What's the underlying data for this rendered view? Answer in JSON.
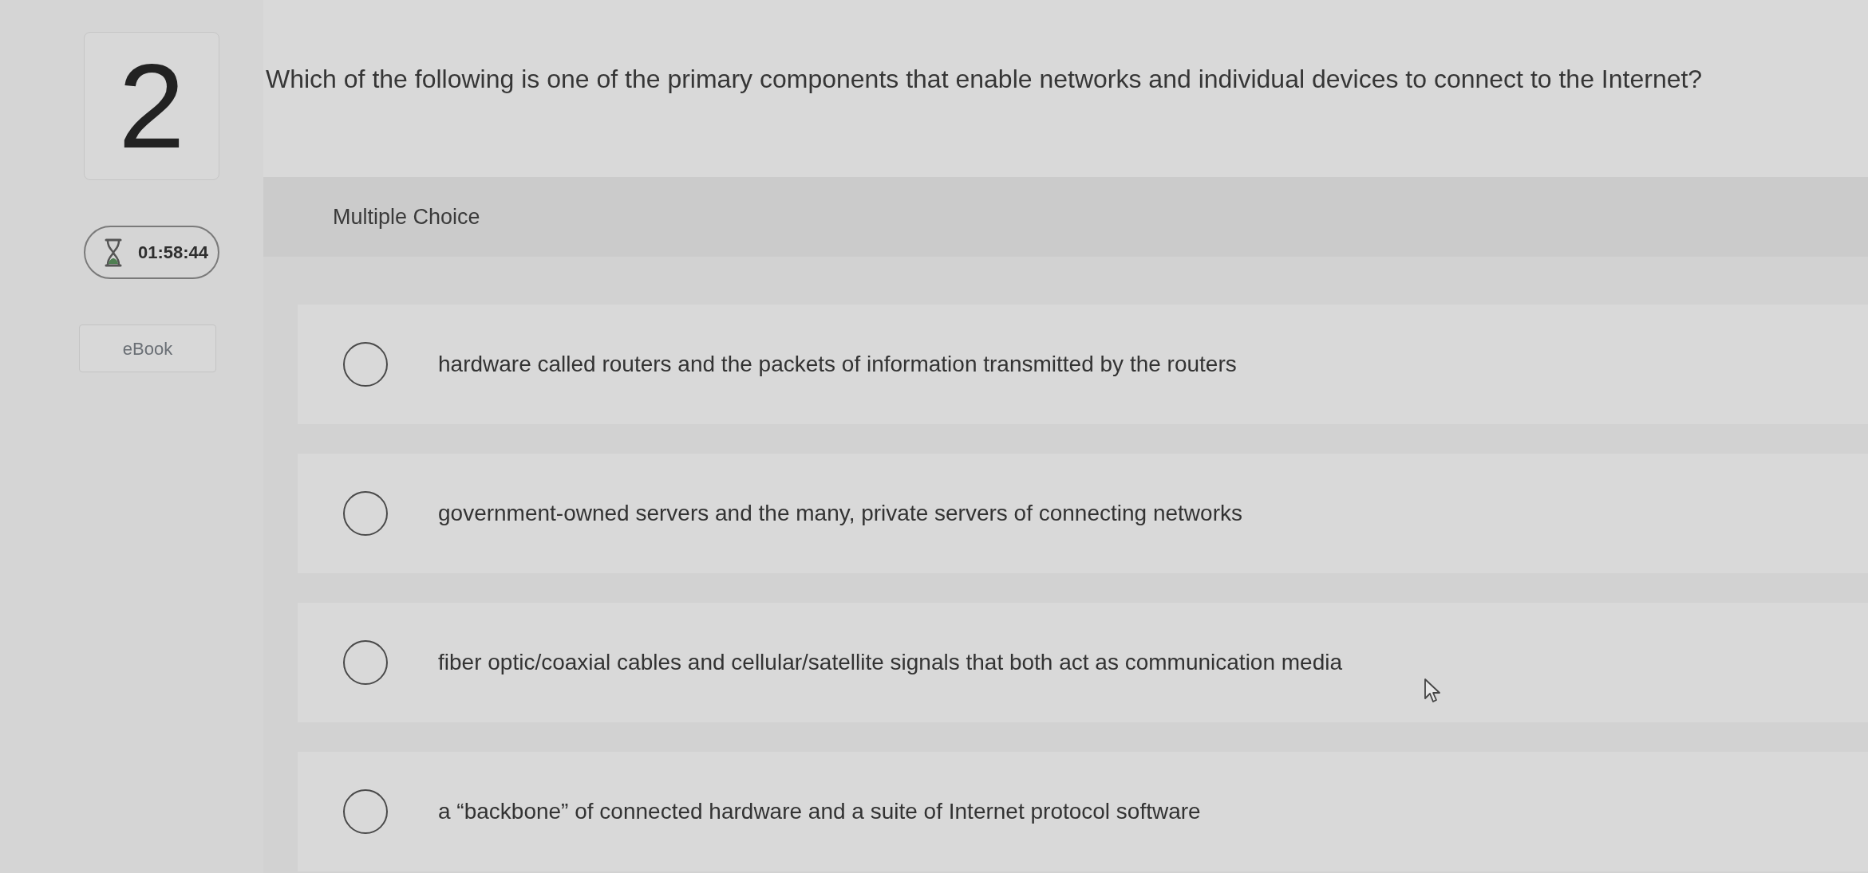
{
  "question": {
    "number": "2",
    "text": "Which of the following is one of the primary components that enable networks and individual devices to connect to the Internet?"
  },
  "timer": {
    "time": "01:58:44"
  },
  "ebook_button": {
    "label": "eBook"
  },
  "answer_panel": {
    "type_label": "Multiple Choice",
    "options": [
      {
        "text": "hardware called routers and the packets of information transmitted by the routers",
        "selected": false
      },
      {
        "text": "government-owned servers and the many, private servers of connecting networks",
        "selected": false
      },
      {
        "text": "fiber optic/coaxial cables and cellular/satellite signals that both act as communication media",
        "selected": false
      },
      {
        "text": "a “backbone” of connected hardware and a suite of Internet protocol software",
        "selected": false
      }
    ]
  }
}
